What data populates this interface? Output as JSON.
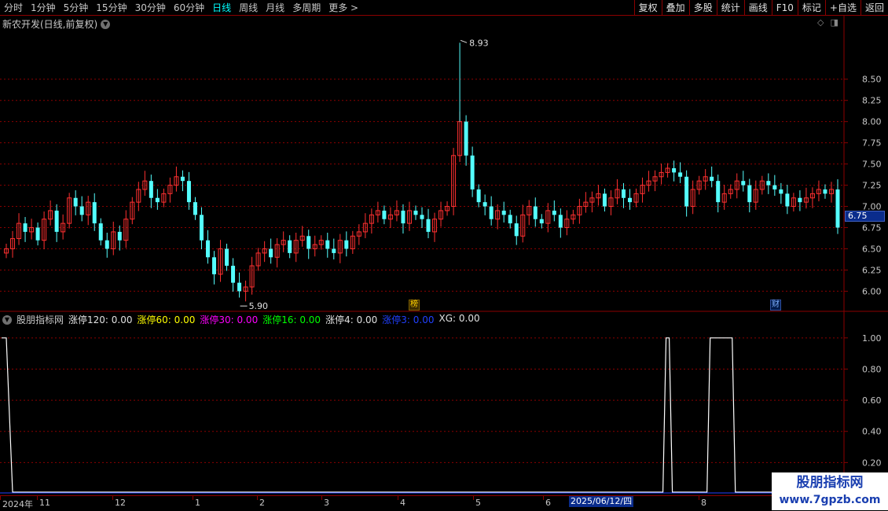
{
  "toolbar": {
    "periods": [
      {
        "label": "分时",
        "active": false
      },
      {
        "label": "1分钟",
        "active": false
      },
      {
        "label": "5分钟",
        "active": false
      },
      {
        "label": "15分钟",
        "active": false
      },
      {
        "label": "30分钟",
        "active": false
      },
      {
        "label": "60分钟",
        "active": false
      },
      {
        "label": "日线",
        "active": true
      },
      {
        "label": "周线",
        "active": false
      },
      {
        "label": "月线",
        "active": false
      },
      {
        "label": "多周期",
        "active": false
      },
      {
        "label": "更多 >",
        "active": false
      }
    ],
    "tools": [
      "复权",
      "叠加",
      "多股",
      "统计",
      "画线",
      "F10",
      "标记",
      "+自选",
      "返回"
    ]
  },
  "stock": {
    "title": "新农开发(日线,前复权)",
    "current_price": "6.75",
    "high_label": "8.93",
    "low_label": "5.90",
    "marker_bang": "榜",
    "marker_cai": "财"
  },
  "indicator": {
    "name": "股朋指标网",
    "items": [
      {
        "label": "涨停120: 0.00",
        "color": "#e0e0e0"
      },
      {
        "label": "涨停60: 0.00",
        "color": "#ffff00"
      },
      {
        "label": "涨停30: 0.00",
        "color": "#ff00ff"
      },
      {
        "label": "涨停16: 0.00",
        "color": "#00ff00"
      },
      {
        "label": "涨停4: 0.00",
        "color": "#e0e0e0"
      },
      {
        "label": "涨停3: 0.00",
        "color": "#2040ff"
      },
      {
        "label": "XG: 0.00",
        "color": "#e0e0e0"
      }
    ]
  },
  "dates": {
    "labels": [
      "2024年",
      "11",
      "12",
      "1",
      "2",
      "3",
      "4",
      "5",
      "6",
      "8"
    ],
    "cursor": "2025/06/12/四"
  },
  "watermark": {
    "line1": "股朋指标网",
    "line2": "www.7gpzb.com"
  },
  "colors": {
    "up": "#ff3030",
    "down": "#54ffff",
    "grid": "#8b0000",
    "axis_text": "#c8c8c8"
  },
  "chart_data": [
    {
      "type": "candlestick",
      "title": "新农开发(日线,前复权)",
      "y_ticks": [
        6.0,
        6.25,
        6.5,
        6.75,
        7.0,
        7.25,
        7.5,
        7.75,
        8.0,
        8.25,
        8.5
      ],
      "ylim": [
        5.8,
        9.1
      ],
      "grid": true,
      "annotations": [
        {
          "text": "8.93",
          "value": 8.93
        },
        {
          "text": "5.90",
          "value": 5.9
        }
      ],
      "close_series": [
        6.5,
        6.62,
        6.8,
        6.7,
        6.75,
        6.6,
        6.85,
        6.95,
        6.7,
        6.8,
        7.1,
        7.0,
        6.9,
        7.05,
        6.8,
        6.6,
        6.5,
        6.7,
        6.6,
        6.85,
        7.05,
        7.2,
        7.3,
        7.1,
        7.05,
        7.15,
        7.25,
        7.35,
        7.3,
        7.05,
        6.9,
        6.6,
        6.4,
        6.2,
        6.5,
        6.3,
        6.1,
        6.0,
        6.05,
        6.3,
        6.45,
        6.5,
        6.4,
        6.55,
        6.6,
        6.45,
        6.6,
        6.65,
        6.5,
        6.55,
        6.6,
        6.5,
        6.45,
        6.6,
        6.5,
        6.65,
        6.7,
        6.8,
        6.9,
        6.95,
        6.85,
        6.9,
        6.95,
        6.8,
        6.95,
        6.9,
        6.85,
        6.7,
        6.85,
        6.95,
        7.0,
        7.6,
        8.0,
        7.6,
        7.2,
        7.05,
        7.0,
        6.85,
        6.95,
        6.9,
        6.8,
        6.65,
        6.9,
        7.0,
        6.85,
        6.8,
        6.95,
        6.9,
        6.75,
        6.85,
        6.9,
        7.0,
        7.05,
        7.1,
        7.15,
        7.0,
        7.1,
        7.2,
        7.1,
        7.05,
        7.15,
        7.25,
        7.3,
        7.35,
        7.4,
        7.45,
        7.4,
        7.35,
        7.0,
        7.2,
        7.3,
        7.35,
        7.3,
        7.05,
        7.15,
        7.2,
        7.3,
        7.25,
        7.05,
        7.2,
        7.3,
        7.25,
        7.2,
        7.15,
        7.0,
        7.1,
        7.05,
        7.1,
        7.15,
        7.2,
        7.15,
        7.2,
        6.75
      ]
    },
    {
      "type": "line",
      "series": [
        {
          "name": "XG",
          "values": [
            1,
            1,
            0,
            0,
            0,
            0,
            0,
            0,
            0,
            0,
            0,
            0,
            0,
            0,
            0,
            0,
            0,
            0,
            0,
            0,
            0,
            0,
            0,
            0,
            0,
            0,
            0,
            0,
            0,
            0,
            0,
            0,
            0,
            0,
            0,
            0,
            0,
            0,
            0,
            0,
            0,
            0,
            0,
            0,
            0,
            0,
            0,
            0,
            0,
            0,
            0,
            0,
            0,
            0,
            0,
            0,
            0,
            0,
            0,
            0,
            0,
            0,
            0,
            0,
            0,
            0,
            0,
            0,
            0,
            0,
            0,
            0,
            0,
            0,
            0,
            0,
            0,
            0,
            0,
            0,
            0,
            0,
            0,
            0,
            0,
            0,
            0,
            0,
            0,
            0,
            0,
            0,
            0,
            0,
            0,
            0,
            0,
            0,
            0,
            0,
            0,
            0,
            0,
            0,
            0,
            0,
            0,
            0,
            0,
            0,
            0,
            0,
            0,
            0,
            0,
            0,
            0,
            0,
            0,
            0,
            0,
            0,
            0,
            0,
            0,
            0,
            0,
            0,
            0,
            0,
            0,
            0,
            0,
            0,
            0,
            0,
            0,
            0,
            0,
            0
          ]
        }
      ],
      "pulses": [
        {
          "from_index": 0,
          "to_index": 1
        },
        {
          "from_index": 105,
          "to_index": 106
        },
        {
          "from_index": 112,
          "to_index": 116
        }
      ],
      "y_ticks": [
        0.2,
        0.4,
        0.6,
        0.8,
        1.0
      ],
      "ylim": [
        0.0,
        1.1
      ],
      "grid": true
    }
  ]
}
